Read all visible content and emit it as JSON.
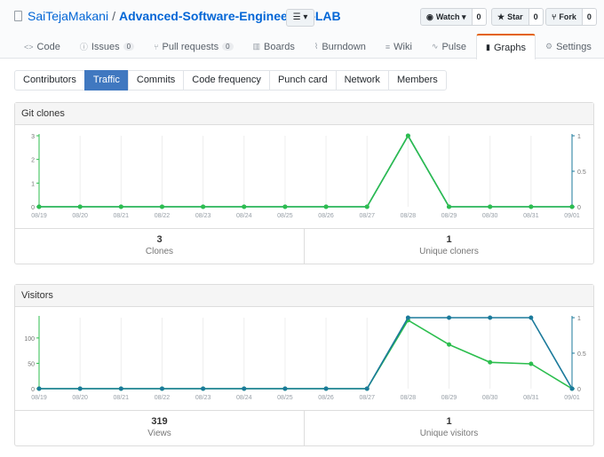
{
  "repo": {
    "owner": "SaiTejaMakani",
    "separator": "/",
    "name": "Advanced-Software-Engineering-LAB",
    "list_label": "☰ ▾"
  },
  "actions": {
    "watch": {
      "label": "Watch ▾",
      "count": "0"
    },
    "star": {
      "label": "Star",
      "count": "0"
    },
    "fork": {
      "label": "Fork",
      "count": "0"
    }
  },
  "tabs": [
    {
      "icon": "<>",
      "label": "Code"
    },
    {
      "icon": "ⓘ",
      "label": "Issues",
      "count": "0"
    },
    {
      "icon": "⑂",
      "label": "Pull requests",
      "count": "0"
    },
    {
      "icon": "▥",
      "label": "Boards"
    },
    {
      "icon": "⌇",
      "label": "Burndown"
    },
    {
      "icon": "≡",
      "label": "Wiki"
    },
    {
      "icon": "∿",
      "label": "Pulse"
    },
    {
      "icon": "▮",
      "label": "Graphs"
    },
    {
      "icon": "⚙",
      "label": "Settings"
    }
  ],
  "subnav": [
    "Contributors",
    "Traffic",
    "Commits",
    "Code frequency",
    "Punch card",
    "Network",
    "Members"
  ],
  "colors": {
    "total_line": "#1b7a9b",
    "unique_line": "#2cbe4e",
    "accent_tab": "#e36209",
    "selected_subnav": "#4078c0"
  },
  "clones": {
    "title": "Git clones",
    "stats": {
      "total": "3",
      "total_label": "Clones",
      "unique": "1",
      "unique_label": "Unique cloners"
    }
  },
  "visitors": {
    "title": "Visitors",
    "stats": {
      "total": "319",
      "total_label": "Views",
      "unique": "1",
      "unique_label": "Unique visitors"
    }
  },
  "chart_data": [
    {
      "type": "line",
      "title": "Git clones",
      "x": [
        "08/19",
        "08/20",
        "08/21",
        "08/22",
        "08/23",
        "08/24",
        "08/25",
        "08/26",
        "08/27",
        "08/28",
        "08/29",
        "08/30",
        "08/31",
        "09/01"
      ],
      "left_ticks": [
        "0",
        "1",
        "2",
        "3"
      ],
      "right_ticks": [
        "0",
        "0.5",
        "1"
      ],
      "ylim_left": [
        0,
        3
      ],
      "ylim_right": [
        0,
        1
      ],
      "series": [
        {
          "values": [
            0,
            0,
            0,
            0,
            0,
            0,
            0,
            0,
            0,
            3,
            0,
            0,
            0,
            0
          ],
          "axis": "left",
          "color": "#1b7a9b"
        },
        {
          "values": [
            0,
            0,
            0,
            0,
            0,
            0,
            0,
            0,
            0,
            1,
            0,
            0,
            0,
            0
          ],
          "axis": "right",
          "color": "#2cbe4e"
        }
      ]
    },
    {
      "type": "line",
      "title": "Visitors",
      "x": [
        "08/19",
        "08/20",
        "08/21",
        "08/22",
        "08/23",
        "08/24",
        "08/25",
        "08/26",
        "08/27",
        "08/28",
        "08/29",
        "08/30",
        "08/31",
        "09/01"
      ],
      "left_ticks": [
        "0",
        "50",
        "100"
      ],
      "right_ticks": [
        "0",
        "0.5",
        "1"
      ],
      "ylim_left": [
        0,
        140
      ],
      "ylim_right": [
        0,
        1
      ],
      "series": [
        {
          "values": [
            0,
            0,
            0,
            0,
            0,
            0,
            0,
            0,
            0,
            135,
            87,
            52,
            49,
            0
          ],
          "axis": "left",
          "color": "#2cbe4e"
        },
        {
          "values": [
            0,
            0,
            0,
            0,
            0,
            0,
            0,
            0,
            0,
            1,
            1,
            1,
            1,
            0
          ],
          "axis": "right",
          "color": "#1b7a9b"
        }
      ]
    }
  ]
}
